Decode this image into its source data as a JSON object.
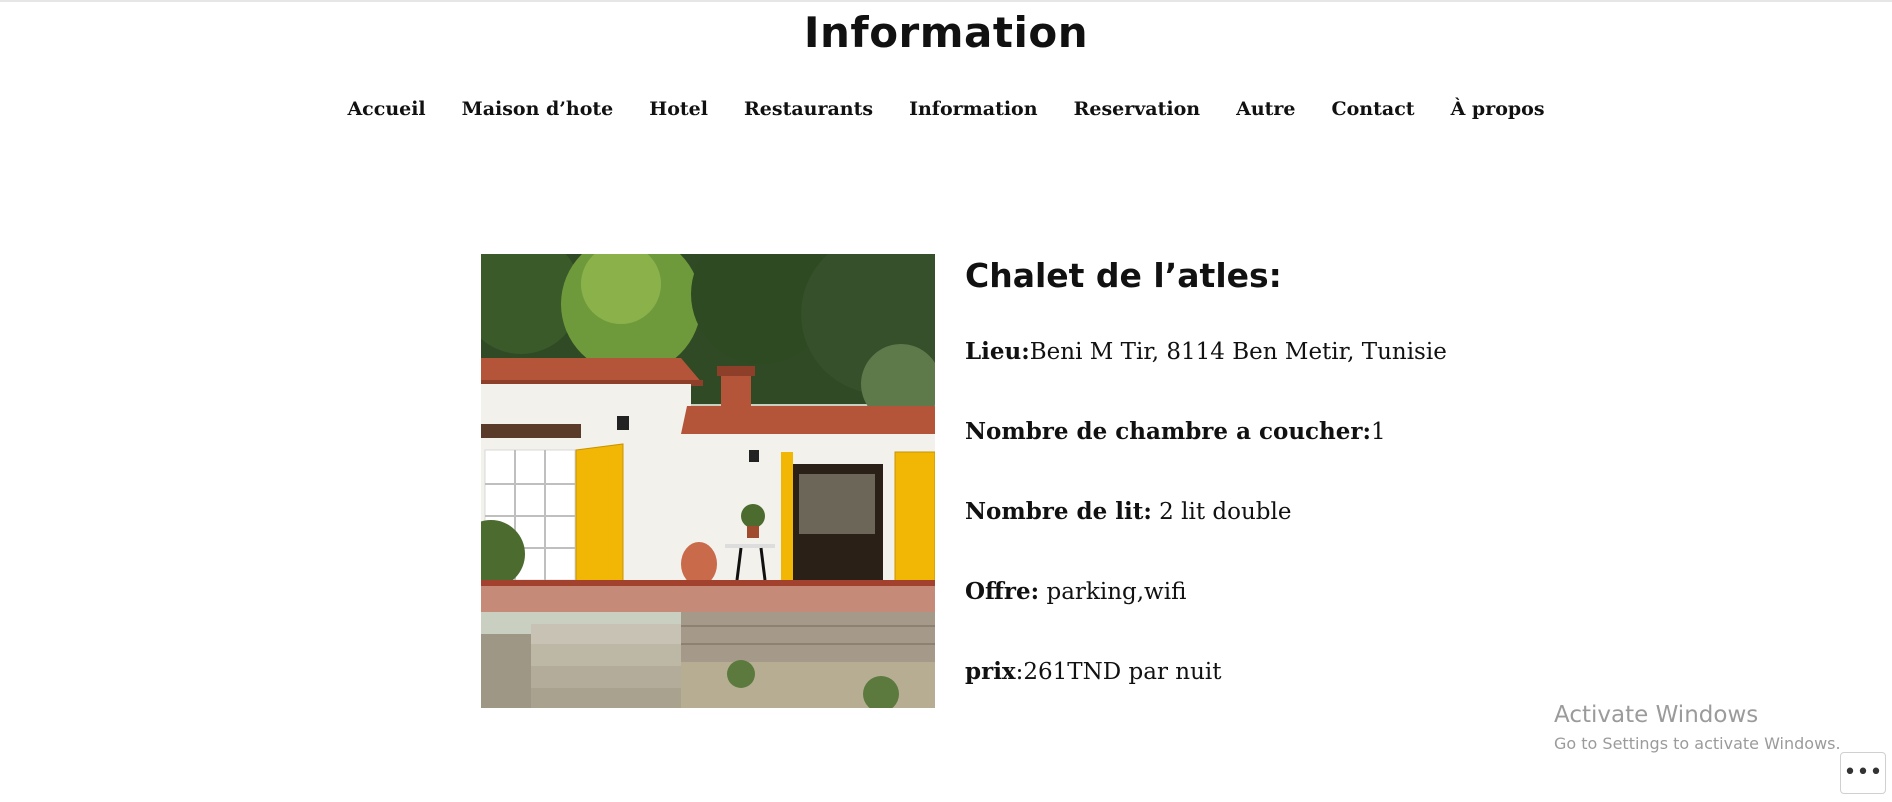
{
  "header": {
    "site_title": "Information"
  },
  "nav": {
    "items": [
      {
        "label": "Accueil"
      },
      {
        "label": "Maison d’hote"
      },
      {
        "label": "Hotel"
      },
      {
        "label": "Restaurants"
      },
      {
        "label": "Information"
      },
      {
        "label": "Reservation"
      },
      {
        "label": "Autre"
      },
      {
        "label": "Contact"
      },
      {
        "label": "À propos"
      }
    ]
  },
  "listing": {
    "title": "Chalet de l’atles:",
    "lieu_label": "Lieu:",
    "lieu_value": "Beni M Tir, 8114 Ben Metir, Tunisie",
    "chambre_label": "Nombre de chambre a coucher:",
    "chambre_value": "1",
    "lit_label": "Nombre de lit:",
    "lit_value": " 2 lit double",
    "offre_label": "Offre:",
    "offre_value": " parking,wifi",
    "prix_label": "prix",
    "prix_value": ":261TND par nuit"
  },
  "overlay": {
    "activate_title": "Activate Windows",
    "activate_subtitle": "Go to Settings to activate Windows.",
    "more_button": "•••"
  },
  "colors": {
    "shutter_yellow": "#f2b705",
    "roof_terracotta": "#b4553a",
    "wall_white": "#f3f1ec",
    "foliage_green": "#3f5a2c"
  }
}
